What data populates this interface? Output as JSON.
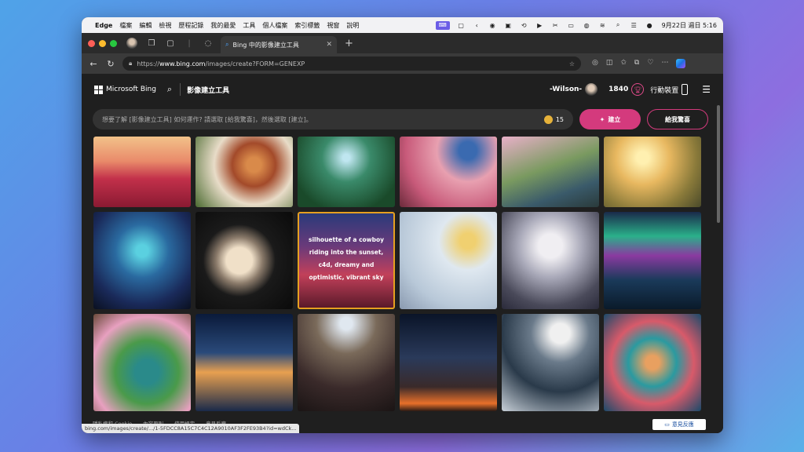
{
  "menubar": {
    "app": "Edge",
    "items": [
      "檔案",
      "編輯",
      "檢視",
      "歷程記錄",
      "我的最愛",
      "工具",
      "個人檔案",
      "索引標籤",
      "視窗",
      "說明"
    ],
    "clock": "9月22日 週日 5:16"
  },
  "tab": {
    "title": "Bing 中的影像建立工具"
  },
  "address": {
    "scheme": "https://",
    "host": "www.bing.com",
    "path": "/images/create?FORM=GENEXP"
  },
  "header": {
    "brand": "Microsoft Bing",
    "product": "影像建立工具",
    "user": "-Wilson-",
    "points": "1840",
    "mobile": "行動裝置"
  },
  "prompt": {
    "placeholder": "想要了解 [影像建立工具] 如何運作? 請選取 [給我驚喜]，然後選取 [建立]。",
    "boosts": "15",
    "create_label": "建立",
    "surprise_label": "給我驚喜"
  },
  "gallery": {
    "hover_caption": "silhouette of a cowboy riding into the sunset, c4d, dreamy and optimistic, vibrant sky"
  },
  "footer": {
    "links": [
      "隱私權和 Cookie",
      "內容原則",
      "使用規定",
      "意見反應"
    ],
    "status_url": "bing.com/images/create/.../1-5FDCC8A15C7C4C12A9010AF3F2FE93B4?id=wdCk...",
    "feedback": "意見反應"
  },
  "colors": {
    "accent": "#d43a7d",
    "highlight": "#e6a020"
  }
}
